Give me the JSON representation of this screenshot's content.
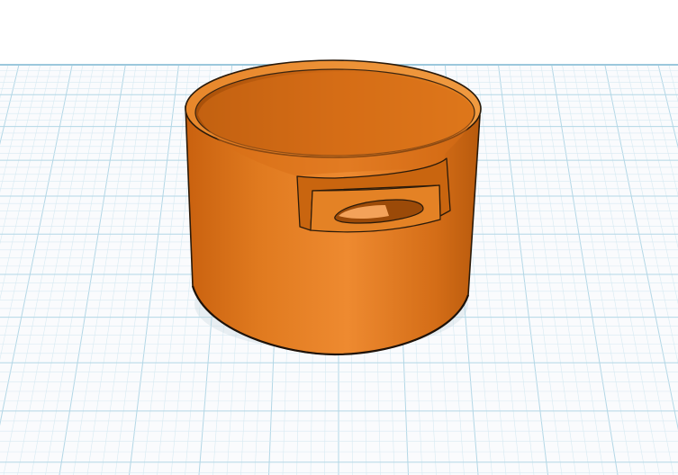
{
  "workspace": {
    "background_color": "#fafbfd",
    "grid_minor_color": "#d7eaf2",
    "grid_major_color": "#b3d7e6",
    "horizon_color": "#9cc8dc"
  },
  "model": {
    "shape": "hollow cylinder with rectangular notch and slot",
    "body_color": "#e07a1f",
    "shadow_color": "#b85a0d",
    "highlight_color": "#f08a32",
    "outline_color": "#2a1a0a",
    "slot_icon": "half-moon-slot-icon"
  }
}
